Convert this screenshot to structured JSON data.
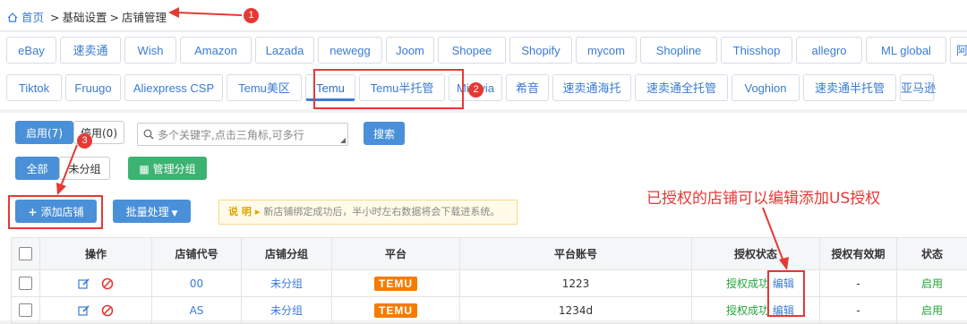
{
  "breadcrumb": {
    "home": "首页",
    "sep": ">",
    "level2": "基础设置",
    "current": "店铺管理"
  },
  "tabs_row1": [
    "eBay",
    "速卖通",
    "Wish",
    "Amazon",
    "Lazada",
    "newegg",
    "Joom",
    "Shopee",
    "Shopify",
    "mycom",
    "Shopline",
    "Thisshop",
    "allegro",
    "ML global",
    "阿里"
  ],
  "tabs_row2": [
    "Tiktok",
    "Fruugo",
    "Aliexpress CSP",
    "Temu美区",
    "Temu",
    "Temu半托管",
    "Miravia",
    "希音",
    "速卖通海托",
    "速卖通全托管",
    "Voghion",
    "速卖通半托管",
    "亚马逊"
  ],
  "active_tab": "Temu",
  "filters": {
    "enabled": "启用(7)",
    "disabled": "停用(0)",
    "search_placeholder": "多个关键字,点击三角标,可多行",
    "search_btn": "搜索",
    "all": "全部",
    "ungrouped": "未分组",
    "manage_groups": "管理分组"
  },
  "actions": {
    "add_store": "添加店铺",
    "batch": "批量处理"
  },
  "notice": {
    "label": "说 明",
    "text": "新店铺绑定成功后，半小时左右数据将会下载进系统。"
  },
  "table": {
    "headers": [
      "",
      "操作",
      "店铺代号",
      "店铺分组",
      "平台",
      "平台账号",
      "授权状态",
      "授权有效期",
      "状态"
    ],
    "rows": [
      {
        "code": "00",
        "group": "未分组",
        "platform": "TEMU",
        "account": "1223",
        "auth": "授权成功",
        "edit": "编辑",
        "validity": "-",
        "status": "启用"
      },
      {
        "code": "AS",
        "group": "未分组",
        "platform": "TEMU",
        "account": "1234d",
        "auth": "授权成功",
        "edit": "编辑",
        "validity": "-",
        "status": "启用"
      }
    ]
  },
  "annotations": {
    "n1": "1",
    "n2": "2",
    "n3": "3",
    "note": "已授权的店铺可以编辑添加US授权"
  },
  "colors": {
    "accent": "#4a90d9",
    "annotation": "#e53935",
    "temu": "#f57c00",
    "success": "#22a33a"
  }
}
